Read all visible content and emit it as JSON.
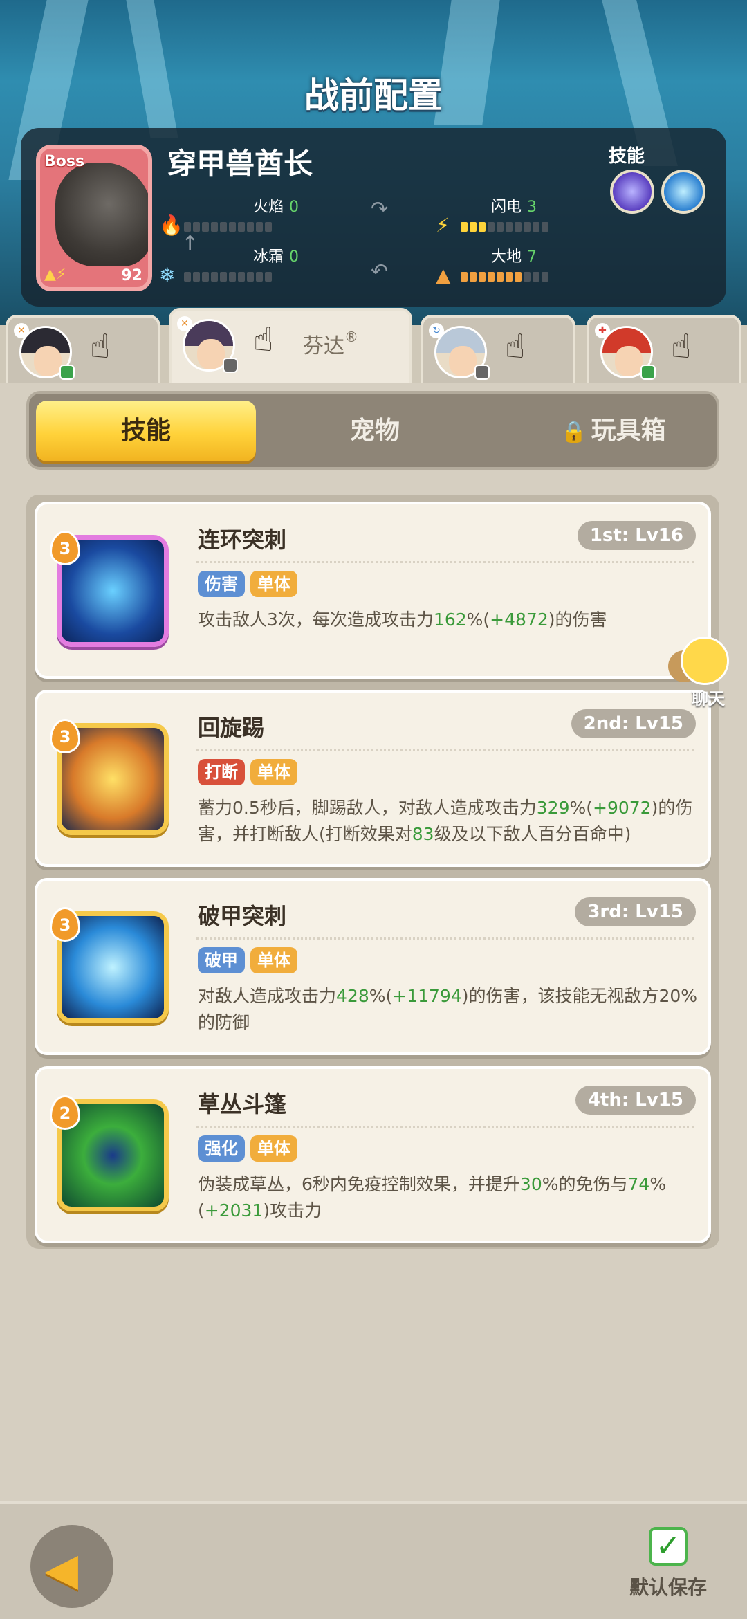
{
  "header": {
    "title": "战前配置"
  },
  "boss": {
    "tag": "Boss",
    "name": "穿甲兽酋长",
    "level": "92",
    "skills_label": "技能",
    "stats": {
      "fire": {
        "label": "火焰",
        "value": "0",
        "filled": 0
      },
      "lightning": {
        "label": "闪电",
        "value": "3",
        "filled": 3
      },
      "ice": {
        "label": "冰霜",
        "value": "0",
        "filled": 0
      },
      "earth": {
        "label": "大地",
        "value": "7",
        "filled": 7
      }
    }
  },
  "heroes": [
    {
      "role_icon": "sword-icon",
      "status": "green"
    },
    {
      "role_icon": "sword-icon",
      "status": "gray",
      "name": "芬达",
      "suffix": "®",
      "active": true
    },
    {
      "role_icon": "swirl-icon",
      "status": "gray"
    },
    {
      "role_icon": "cross-icon",
      "status": "green"
    }
  ],
  "sub_tabs": {
    "skills": "技能",
    "pets": "宠物",
    "toybox": "玩具箱"
  },
  "skill_cards": [
    {
      "level_drop": "3",
      "name": "连环突刺",
      "rank": "1st: Lv16",
      "tags": [
        "伤害",
        "单体"
      ],
      "desc_parts": [
        "攻击敌人3次，每次造成攻击力",
        "162",
        "%(",
        "+4872",
        ")的伤害"
      ]
    },
    {
      "level_drop": "3",
      "name": "回旋踢",
      "rank": "2nd: Lv15",
      "tags": [
        "打断",
        "单体"
      ],
      "desc_parts": [
        "蓄力0.5秒后，脚踢敌人，对敌人造成攻击力",
        "329",
        "%(",
        "+9072",
        ")的伤害，并打断敌人(打断效果对",
        "83",
        "级及以下敌人百分百命中)"
      ]
    },
    {
      "level_drop": "3",
      "name": "破甲突刺",
      "rank": "3rd: Lv15",
      "tags": [
        "破甲",
        "单体"
      ],
      "desc_parts": [
        "对敌人造成攻击力",
        "428",
        "%(",
        "+11794",
        ")的伤害，该技能无视敌方20%的防御"
      ]
    },
    {
      "level_drop": "2",
      "name": "草丛斗篷",
      "rank": "4th: Lv15",
      "tags": [
        "强化",
        "单体"
      ],
      "desc_parts": [
        "伪装成草丛，6秒内免疫控制效果，并提升",
        "30",
        "%的免伤与",
        "74",
        "%(",
        "+2031",
        ")攻击力"
      ]
    }
  ],
  "chat": {
    "label": "聊天"
  },
  "bottom": {
    "save_label": "默认保存"
  },
  "colors": {
    "accent": "#ffd23a",
    "highlight": "#3a9a3a"
  }
}
